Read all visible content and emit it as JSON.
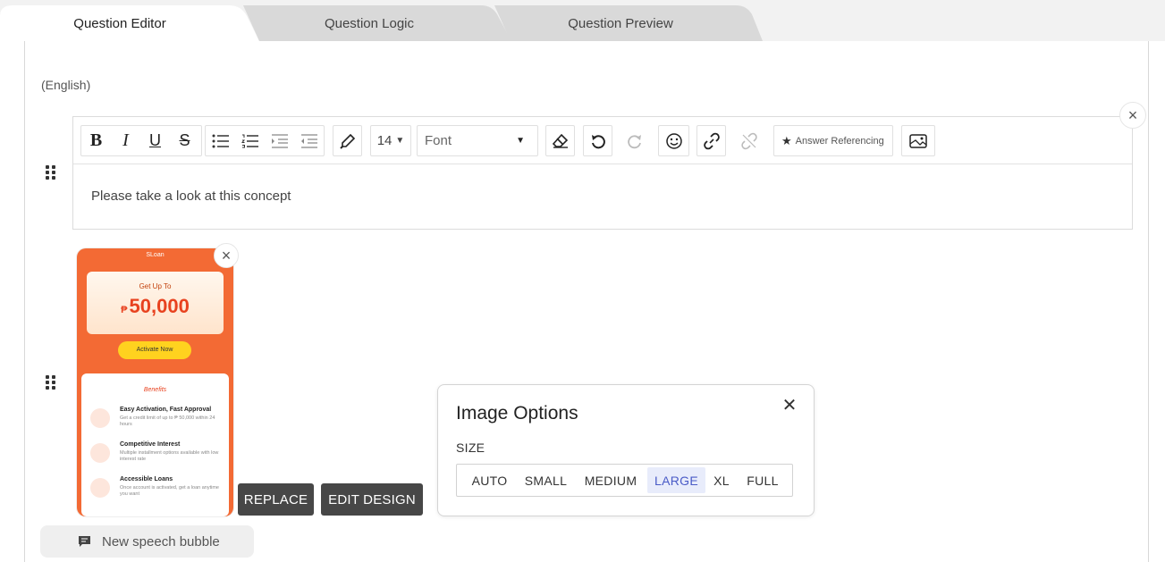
{
  "tabs": [
    {
      "label": "Question Editor",
      "active": true
    },
    {
      "label": "Question Logic",
      "active": false
    },
    {
      "label": "Question Preview",
      "active": false
    }
  ],
  "language_label": "(English)",
  "toolbar": {
    "bold": "B",
    "italic": "I",
    "underline": "U",
    "strike": "S",
    "font_size": "14",
    "font_family": "Font",
    "answer_referencing": "Answer Referencing"
  },
  "editor": {
    "text": "Please take a look at this concept"
  },
  "phone_image": {
    "header": "SLoan",
    "hero_small": "Get Up To",
    "hero_amount": "50,000",
    "hero_currency": "₱",
    "cta": "Activate Now",
    "benefits_heading": "Benefits",
    "benefits": [
      {
        "title": "Easy Activation, Fast Approval",
        "desc": "Get a credit limit of up to ₱ 50,000 within 24 hours"
      },
      {
        "title": "Competitive Interest",
        "desc": "Multiple installment options available with low interest rate"
      },
      {
        "title": "Accessible Loans",
        "desc": "Once account is activated, get a loan anytime you want"
      }
    ]
  },
  "image_buttons": {
    "replace": "REPLACE",
    "edit_design": "EDIT DESIGN"
  },
  "speech_bubble": {
    "label": "New speech bubble"
  },
  "image_options": {
    "title": "Image Options",
    "size_label": "SIZE",
    "sizes": [
      "AUTO",
      "SMALL",
      "MEDIUM",
      "LARGE",
      "XL",
      "FULL"
    ],
    "selected": "LARGE"
  },
  "colors": {
    "accent": "#4a5bc7",
    "selected_bg": "#e8ecfb",
    "dark_button": "#474747",
    "phone_orange": "#f36a34"
  }
}
